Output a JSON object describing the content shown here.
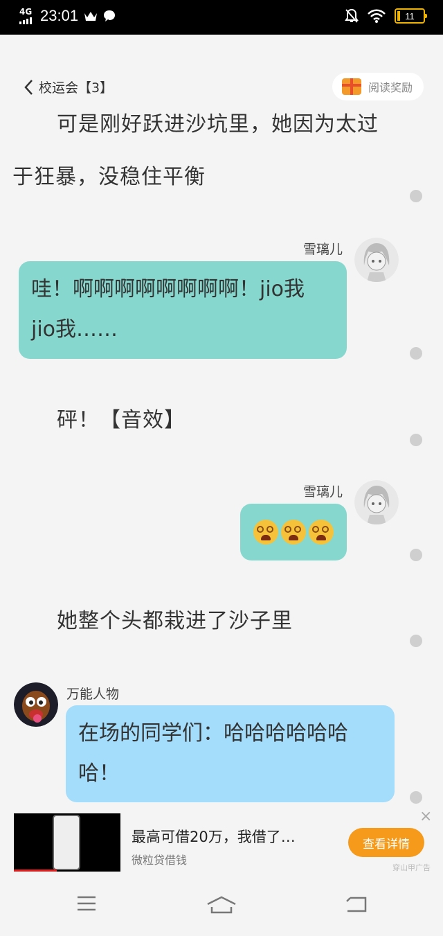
{
  "status": {
    "network": "4G",
    "time": "23:01",
    "battery": "11"
  },
  "header": {
    "title": "校运会【3】",
    "reward_label": "阅读奖励"
  },
  "content": {
    "narration1_line1": "可是刚好跃进沙坑里，她因为太过",
    "narration1_line2": "于狂暴，没稳住平衡",
    "chat1": {
      "name": "雪璃儿",
      "line1": "哇！啊啊啊啊啊啊啊啊！jio我",
      "line2": "jio我……"
    },
    "narration2": "砰！【音效】",
    "chat2": {
      "name": "雪璃儿",
      "emoji_count": 3
    },
    "narration3": "她整个头都栽进了沙子里",
    "chat3": {
      "name": "万能人物",
      "line1": "在场的同学们：哈哈哈哈哈哈",
      "line2": "哈！"
    }
  },
  "ad": {
    "title": "最高可借20万，我借了…",
    "subtitle": "微粒贷借钱",
    "button": "查看详情",
    "tag": "穿山甲广告",
    "close": "×"
  },
  "colors": {
    "teal_bubble": "#86d8cf",
    "blue_bubble": "#a3ddfb",
    "ad_button": "#f59a1a"
  }
}
